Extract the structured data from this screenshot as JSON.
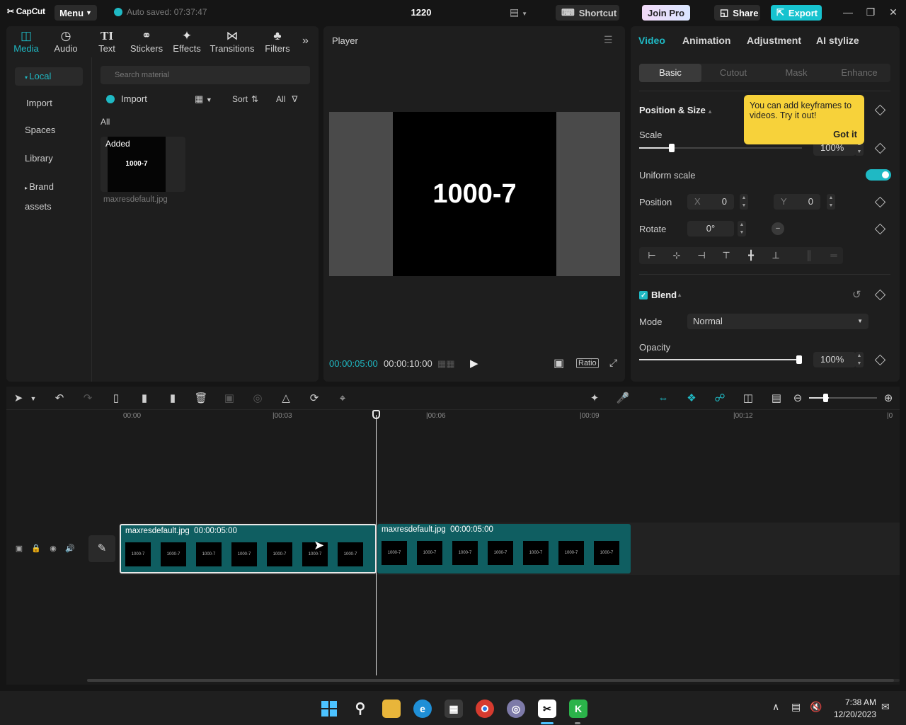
{
  "titlebar": {
    "logo": "CapCut",
    "menu_label": "Menu",
    "autosave": "Auto saved: 07:37:47",
    "project_title": "1220",
    "shortcut_label": "Shortcut",
    "joinpro_label": "Join Pro",
    "share_label": "Share",
    "export_label": "Export"
  },
  "media": {
    "tabs": [
      {
        "label": "Media",
        "icon": "media-icon"
      },
      {
        "label": "Audio",
        "icon": "audio-icon"
      },
      {
        "label": "Text",
        "icon": "text-icon"
      },
      {
        "label": "Stickers",
        "icon": "stickers-icon"
      },
      {
        "label": "Effects",
        "icon": "effects-icon"
      },
      {
        "label": "Transitions",
        "icon": "transitions-icon"
      },
      {
        "label": "Filters",
        "icon": "filters-icon"
      }
    ],
    "sidebar": [
      "Local",
      "Import",
      "Spaces",
      "Library",
      "Brand assets"
    ],
    "search_placeholder": "Search material",
    "import_label": "Import",
    "sort_label": "Sort",
    "filter_label": "All",
    "section_all": "All",
    "thumb_badge": "Added",
    "thumb_text": "1000-7",
    "file_name": "maxresdefault.jpg"
  },
  "player": {
    "title": "Player",
    "frame_text": "1000-7",
    "current_time": "00:00:05:00",
    "total_time": "00:00:10:00",
    "ratio_label": "Ratio"
  },
  "properties": {
    "tabs": [
      "Video",
      "Animation",
      "Adjustment",
      "AI stylize"
    ],
    "subtabs": [
      "Basic",
      "Cutout",
      "Mask",
      "Enhance"
    ],
    "section_position": "Position & Size",
    "scale_label": "Scale",
    "scale_value": "100%",
    "scale_fraction": 0.2,
    "uniform_label": "Uniform scale",
    "position_label": "Position",
    "x_label": "X",
    "x_value": "0",
    "y_label": "Y",
    "y_value": "0",
    "rotate_label": "Rotate",
    "rotate_value": "0°",
    "blend_label": "Blend",
    "mode_label": "Mode",
    "mode_value": "Normal",
    "opacity_label": "Opacity",
    "opacity_value": "100%",
    "tooltip_text": "You can add keyframes to videos. Try it out!",
    "tooltip_button": "Got it"
  },
  "timeline": {
    "ruler": [
      "00:00",
      "|00:03",
      "|00:06",
      "|00:09",
      "|00:12",
      "|0"
    ],
    "clips": [
      {
        "name": "maxresdefault.jpg",
        "duration": "00:00:05:00"
      },
      {
        "name": "maxresdefault.jpg",
        "duration": "00:00:05:00"
      }
    ],
    "frame_text": "1000-7"
  },
  "taskbar": {
    "time": "7:38 AM",
    "date": "12/20/2023"
  },
  "colors": {
    "accent": "#1fb9c4",
    "tooltip": "#f7d23a",
    "clip": "#0f5e61"
  }
}
